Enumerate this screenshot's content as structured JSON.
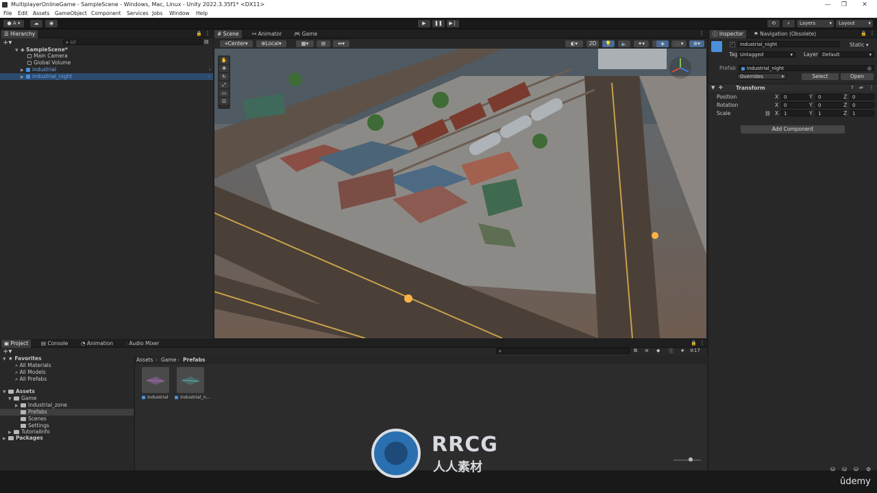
{
  "window": {
    "title": "MultiplayerOnlineGame - SampleScene - Windows, Mac, Linux - Unity 2022.3.35f1* <DX11>",
    "controls": [
      "—",
      "❐",
      "✕"
    ]
  },
  "menu": [
    "File",
    "Edit",
    "Assets",
    "GameObject",
    "Component",
    "Services",
    "Jobs",
    "Window",
    "Help"
  ],
  "toolbar": {
    "account": "A",
    "layers": "Layers",
    "layout": "Layout"
  },
  "hierarchy": {
    "tab": "Hierarchy",
    "search_placeholder": "All",
    "scene": "SampleScene*",
    "items": [
      "Main Camera",
      "Global Volume",
      "industrial",
      "industrial_night"
    ]
  },
  "scene_tabs": [
    "Scene",
    "Animator",
    "Game"
  ],
  "scene_toolbar": {
    "pivot": "Center",
    "space": "Local",
    "mode_2d": "2D"
  },
  "inspector": {
    "tabs": [
      "Inspector",
      "Navigation (Obsolete)"
    ],
    "object_name": "industrial_night",
    "static_label": "Static",
    "tag_label": "Tag",
    "tag_value": "Untagged",
    "layer_label": "Layer",
    "layer_value": "Default",
    "prefab_label": "Prefab",
    "prefab_value": "industrial_night",
    "overrides": "Overrides",
    "select": "Select",
    "open": "Open",
    "transform": {
      "title": "Transform",
      "rows": [
        {
          "label": "Position",
          "x": "0",
          "y": "0",
          "z": "0"
        },
        {
          "label": "Rotation",
          "x": "0",
          "y": "0",
          "z": "0"
        },
        {
          "label": "Scale",
          "x": "1",
          "y": "1",
          "z": "1"
        }
      ]
    },
    "add_component": "Add Component"
  },
  "bottom_tabs": [
    "Project",
    "Console",
    "Animation",
    "Audio Mixer"
  ],
  "project": {
    "favorites_title": "Favorites",
    "favorites": [
      "All Materials",
      "All Models",
      "All Prefabs"
    ],
    "assets_title": "Assets",
    "tree": [
      "Game",
      "Industrial_zone",
      "Prefabs",
      "Scenes",
      "Settings",
      "TutorialInfo",
      "Packages"
    ],
    "breadcrumb": [
      "Assets",
      "Game",
      "Prefabs"
    ],
    "visible_count": "17",
    "files": [
      "industrial",
      "industrial_n..."
    ]
  },
  "watermark": {
    "brand": "RRCG",
    "sub": "人人素材",
    "udemy": "ûdemy"
  },
  "colors": {
    "accent": "#4a90d9",
    "selection": "#2c4a6e"
  }
}
